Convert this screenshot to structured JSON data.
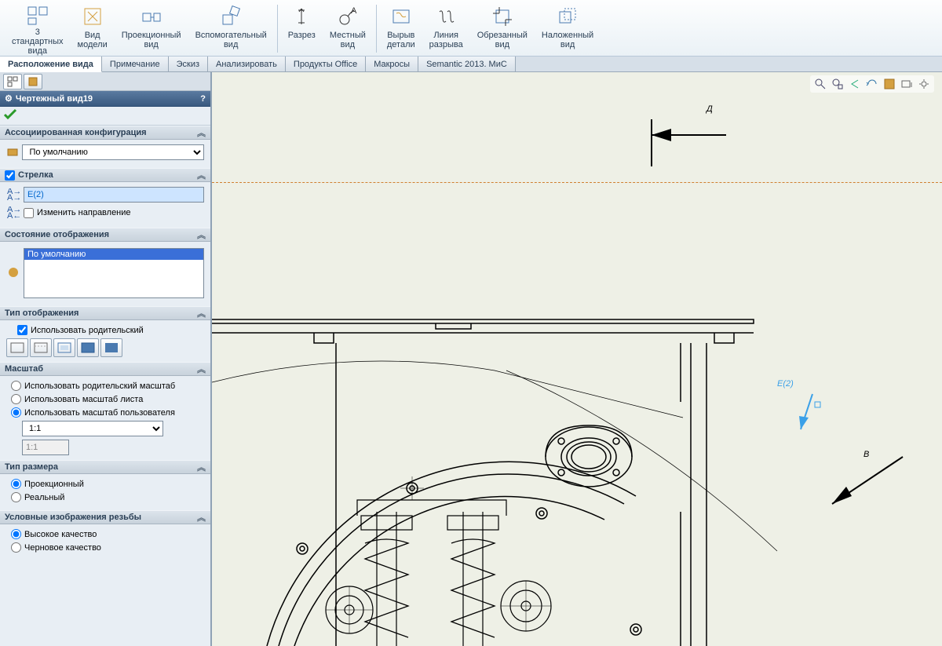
{
  "ribbon": {
    "items": [
      {
        "line1": "3",
        "line2": "стандартных\nвида"
      },
      {
        "line1": "Вид",
        "line2": "модели"
      },
      {
        "line1": "Проекционный",
        "line2": "вид"
      },
      {
        "line1": "Вспомогательный",
        "line2": "вид"
      },
      {
        "line1": "Разрез",
        "line2": ""
      },
      {
        "line1": "Местный",
        "line2": "вид"
      },
      {
        "line1": "Вырыв",
        "line2": "детали"
      },
      {
        "line1": "Линия",
        "line2": "разрыва"
      },
      {
        "line1": "Обрезанный",
        "line2": "вид"
      },
      {
        "line1": "Наложенный",
        "line2": "вид"
      }
    ]
  },
  "tabs": {
    "active": "Расположение вида",
    "items": [
      "Расположение вида",
      "Примечание",
      "Эскиз",
      "Анализировать",
      "Продукты Office",
      "Макросы",
      "Semantic 2013. МиС"
    ]
  },
  "panel": {
    "title": "Чертежный вид19",
    "sections": {
      "config": {
        "title": "Ассоциированная конфигурация",
        "value": "По умолчанию"
      },
      "arrow": {
        "title": "Стрелка",
        "checked": true,
        "value": "Е(2)",
        "reverse_label": "Изменить направление"
      },
      "display_state": {
        "title": "Состояние отображения",
        "item": "По умолчанию"
      },
      "display_type": {
        "title": "Тип отображения",
        "use_parent": "Использовать родительский"
      },
      "scale": {
        "title": "Масштаб",
        "opt1": "Использовать родительский масштаб",
        "opt2": "Использовать масштаб листа",
        "opt3": "Использовать масштаб пользователя",
        "value": "1:1",
        "text": "1:1"
      },
      "dim_type": {
        "title": "Тип размера",
        "opt1": "Проекционный",
        "opt2": "Реальный"
      },
      "thread": {
        "title": "Условные изображения резьбы",
        "opt1": "Высокое качество",
        "opt2": "Черновое качество"
      }
    }
  },
  "drawing": {
    "label_d": "Д",
    "label_e": "Е(2)",
    "label_b": "В"
  }
}
